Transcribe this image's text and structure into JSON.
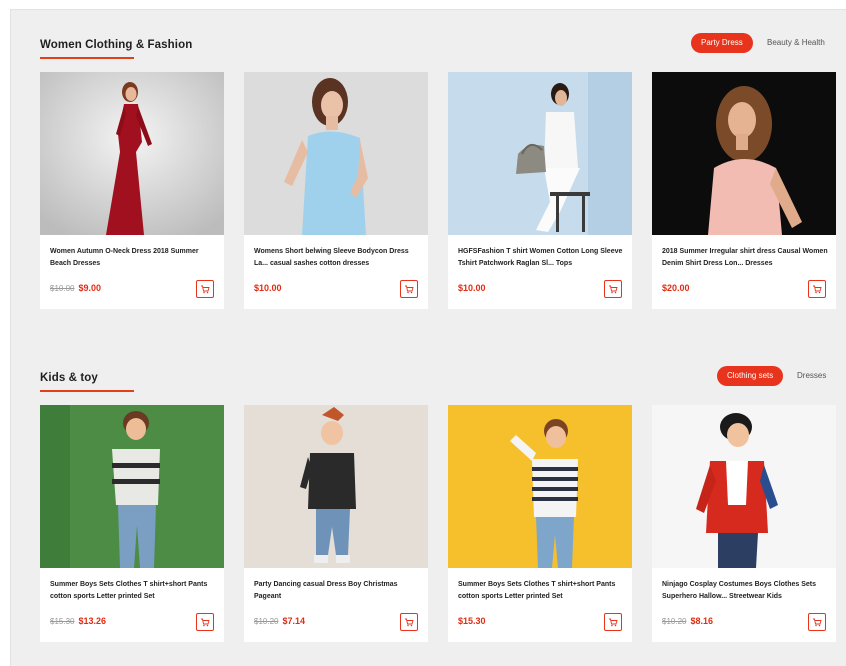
{
  "sections": [
    {
      "title": "Women Clothing & Fashion",
      "tabs": [
        {
          "label": "Party Dress",
          "active": true
        },
        {
          "label": "Beauty & Health",
          "active": false
        }
      ],
      "products": [
        {
          "title": "Women Autumn O-Neck Dress 2018 Summer Beach Dresses",
          "old_price": "$10.00",
          "price": "$9.00"
        },
        {
          "title": "Womens Short belwing Sleeve Bodycon Dress La... casual sashes cotton dresses",
          "old_price": "",
          "price": "$10.00"
        },
        {
          "title": "HGFSFashion T shirt Women Cotton Long Sleeve Tshirt Patchwork Raglan Sl... Tops",
          "old_price": "",
          "price": "$10.00"
        },
        {
          "title": "2018 Summer Irregular shirt dress Causal Women Denim Shirt Dress Lon... Dresses",
          "old_price": "",
          "price": "$20.00"
        }
      ]
    },
    {
      "title": "Kids & toy",
      "tabs": [
        {
          "label": "Clothing sets",
          "active": true
        },
        {
          "label": "Dresses",
          "active": false
        }
      ],
      "products": [
        {
          "title": "Summer Boys Sets Clothes T shirt+short Pants cotton sports Letter printed Set",
          "old_price": "$15.30",
          "price": "$13.26"
        },
        {
          "title": "Party Dancing casual Dress Boy Christmas Pageant",
          "old_price": "$10.20",
          "price": "$7.14"
        },
        {
          "title": "Summer Boys Sets Clothes T shirt+short Pants cotton sports Letter printed Set",
          "old_price": "",
          "price": "$15.30"
        },
        {
          "title": "Ninjago Cosplay Costumes Boys Clothes Sets Superhero Hallow... Streetwear Kids",
          "old_price": "$10.20",
          "price": "$8.16"
        }
      ]
    }
  ],
  "icons": {
    "cart": "cart-icon"
  },
  "colors": {
    "accent": "#e8341c",
    "price": "#e22b12",
    "background": "#efefef"
  }
}
